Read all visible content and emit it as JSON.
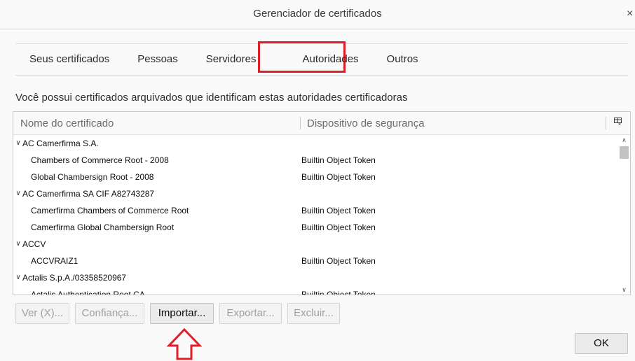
{
  "window": {
    "title": "Gerenciador de certificados",
    "close_glyph": "×"
  },
  "tabs": [
    {
      "label": "Seus certificados",
      "selected": false
    },
    {
      "label": "Pessoas",
      "selected": false
    },
    {
      "label": "Servidores",
      "selected": false
    },
    {
      "label": "Autoridades",
      "selected": true
    },
    {
      "label": "Outros",
      "selected": false
    }
  ],
  "description": "Você possui certificados arquivados que identificam estas autoridades certificadoras",
  "tree": {
    "columns": {
      "name": "Nome do certificado",
      "device": "Dispositivo de segurança",
      "picker_icon": "column-picker-icon"
    },
    "rows": [
      {
        "type": "group",
        "name": "AC Camerfirma S.A.",
        "device": ""
      },
      {
        "type": "child",
        "name": "Chambers of Commerce Root - 2008",
        "device": "Builtin Object Token"
      },
      {
        "type": "child",
        "name": "Global Chambersign Root - 2008",
        "device": "Builtin Object Token"
      },
      {
        "type": "group",
        "name": "AC Camerfirma SA CIF A82743287",
        "device": ""
      },
      {
        "type": "child",
        "name": "Camerfirma Chambers of Commerce Root",
        "device": "Builtin Object Token"
      },
      {
        "type": "child",
        "name": "Camerfirma Global Chambersign Root",
        "device": "Builtin Object Token"
      },
      {
        "type": "group",
        "name": "ACCV",
        "device": ""
      },
      {
        "type": "child",
        "name": "ACCVRAIZ1",
        "device": "Builtin Object Token"
      },
      {
        "type": "group",
        "name": "Actalis S.p.A./03358520967",
        "device": ""
      },
      {
        "type": "child",
        "name": "Actalis Authentication Root CA",
        "device": "Builtin Object Token"
      }
    ]
  },
  "buttons": {
    "view": "Ver (X)...",
    "trust": "Confiança...",
    "import": "Importar...",
    "export": "Exportar...",
    "delete": "Excluir...",
    "ok": "OK"
  },
  "colors": {
    "annotation_red": "#e01e2a",
    "background": "#f9f9fa"
  }
}
